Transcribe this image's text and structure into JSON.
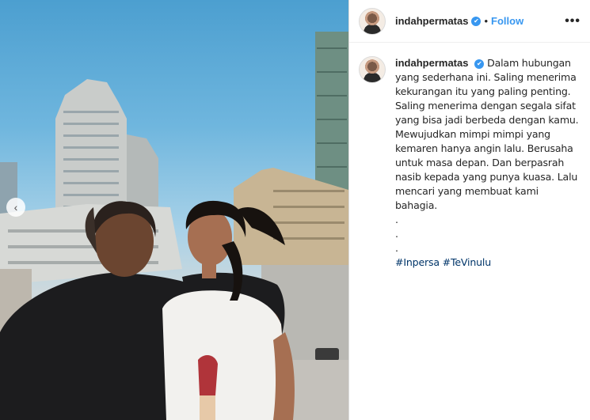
{
  "post": {
    "username": "indahpermatas",
    "verified_badge": "✔",
    "separator": "•",
    "follow_label": "Follow",
    "more_icon": "•••",
    "caption_lines": [
      "Dalam hubungan",
      "yang sederhana ini. Saling menerima",
      "kekurangan itu yang paling penting.",
      "Saling menerima dengan segala sifat",
      "yang bisa jadi berbeda dengan kamu.",
      "Mewujudkan mimpi mimpi yang",
      "kemaren hanya angin lalu. Berusaha",
      "untuk masa depan. Dan berpasrah",
      "nasib kepada yang punya kuasa. Lalu",
      "mencari yang membuat kami bahagia.",
      ".",
      ".",
      "."
    ],
    "hashtags": [
      "#Inpersa",
      "#TeVinulu"
    ]
  },
  "photo": {
    "nav_prev_icon": "‹"
  },
  "colors": {
    "link_blue": "#3897f0",
    "hashtag_blue": "#003569",
    "border": "#dbdbdb"
  }
}
